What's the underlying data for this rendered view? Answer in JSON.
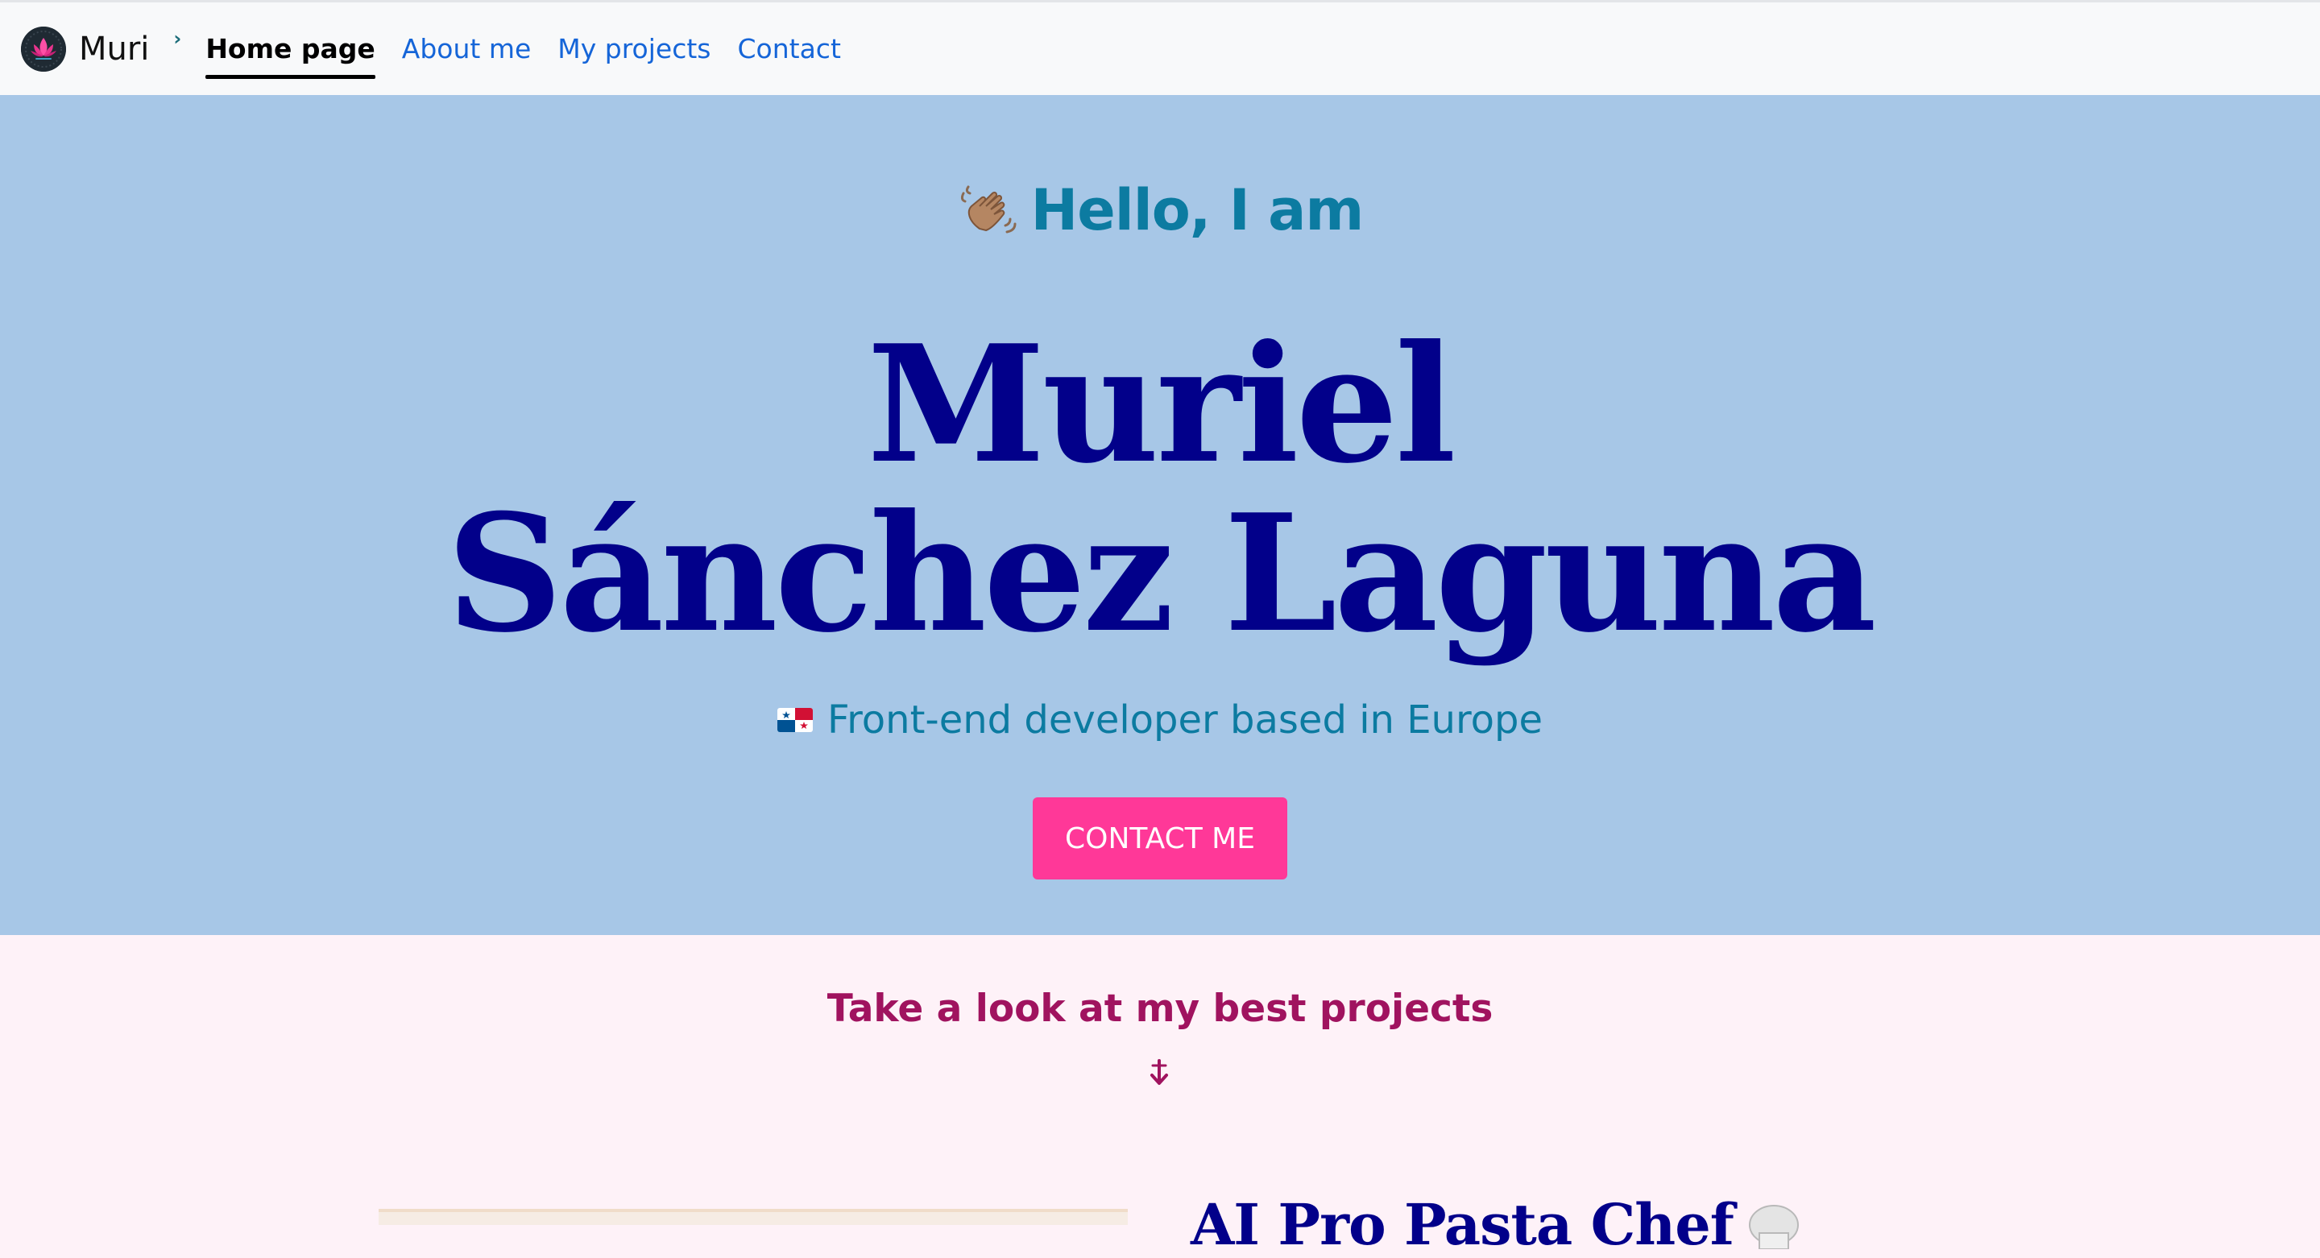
{
  "navbar": {
    "brand": "Muri",
    "toggler_glyph": "›",
    "links": [
      {
        "label": "Home page",
        "active": true
      },
      {
        "label": "About me",
        "active": false
      },
      {
        "label": "My projects",
        "active": false
      },
      {
        "label": "Contact",
        "active": false
      }
    ]
  },
  "hero": {
    "greeting": "Hello, I am",
    "greeting_icon": "waving-hand-icon",
    "name_line1": "Muriel",
    "name_line2": "Sánchez Laguna",
    "subtitle": "Front-end developer based in Europe",
    "subtitle_icon": "panama-flag-icon",
    "cta": "CONTACT ME"
  },
  "projects": {
    "heading": "Take a look at my best projects",
    "arrow_icon": "arrow-down-icon",
    "first_project_title": "AI Pro Pasta Chef"
  },
  "colors": {
    "hero_bg": "#a7c7e7",
    "projects_bg": "#fef2f8",
    "name": "#02008a",
    "accent_teal": "#0c7ba1",
    "cta_bg": "#ff3898",
    "projects_heading": "#a0135f",
    "nav_link": "#1565d8"
  }
}
